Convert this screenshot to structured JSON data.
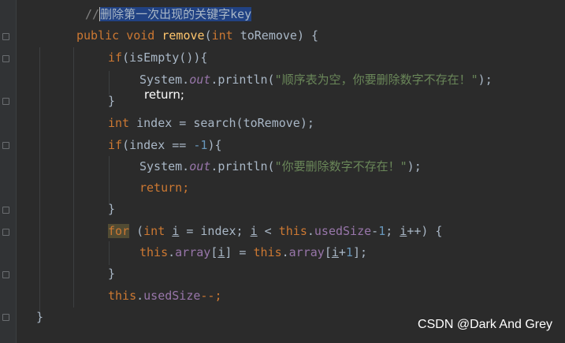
{
  "code": {
    "comment": "//删除第一次出现的关键字key",
    "comment_prefix": "//",
    "comment_selected": "删除第一次出现的关键字key",
    "l2": {
      "kw1": "public",
      "kw2": "void",
      "fn": "remove",
      "lp": "(",
      "kw3": "int",
      "rest": " toRemove) {"
    },
    "l3": {
      "kw": "if",
      "rest": "(isEmpty()){"
    },
    "l4": {
      "a": "System.",
      "b": "out",
      "c": ".println(",
      "s": "\"顺序表为空，你要删除数字不存在！\"",
      "d": ");"
    },
    "l5": "}",
    "l5b": "return;",
    "l6": {
      "kw": "int",
      "rest": " index = search(toRemove);"
    },
    "l7": {
      "kw": "if",
      "a": "(index == ",
      "n": "-1",
      "b": "){"
    },
    "l8": {
      "a": "System.",
      "b": "out",
      "c": ".println(",
      "s": "\"你要删除数字不存在！\"",
      "d": ");"
    },
    "l9": {
      "kw": "return",
      "d": ";"
    },
    "l10": "}",
    "l11": {
      "kw": "for",
      "a": " (",
      "kw2": "int",
      "sp": " ",
      "i1": "i",
      "b": " = index; ",
      "i2": "i",
      "c": " < ",
      "th": "this",
      "dot": ".",
      "f": "usedSize",
      "m": "-",
      "n": "1",
      "e": "; ",
      "i3": "i",
      "g": "++) {"
    },
    "l12": {
      "th1": "this",
      "dot1": ".",
      "f1": "array",
      "a": "[",
      "i1": "i",
      "b": "] = ",
      "th2": "this",
      "dot2": ".",
      "f2": "array",
      "c": "[",
      "i2": "i",
      "d": "+",
      "n": "1",
      "e": "];"
    },
    "l13": "}",
    "l14": {
      "th": "this",
      "dot": ".",
      "f": "usedSize",
      "a": "--;"
    },
    "l15": "}"
  },
  "watermark": "CSDN @Dark And Grey",
  "colors": {
    "background": "#2b2b2b",
    "keyword": "#cc7832",
    "function": "#ffc66d",
    "string": "#6a8759",
    "number": "#6897bb",
    "field": "#9876aa",
    "comment": "#808080",
    "selection": "#214283"
  }
}
